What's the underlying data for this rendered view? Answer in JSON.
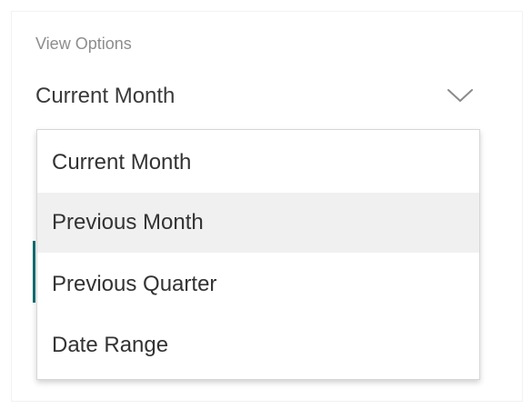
{
  "view_options": {
    "label": "View Options",
    "selected_value": "Current Month",
    "chevron_icon": "chevron-down-icon",
    "hovered_option_index": 1,
    "options": [
      {
        "label": "Current Month"
      },
      {
        "label": "Previous Month"
      },
      {
        "label": "Previous Quarter"
      },
      {
        "label": "Date Range"
      }
    ]
  },
  "colors": {
    "label_text": "#8d8d8d",
    "value_text": "#3a3a3a",
    "menu_text": "#333333",
    "hover_background": "#f0f0f0",
    "accent": "#0f6f73",
    "menu_border": "#d7d7d7"
  }
}
